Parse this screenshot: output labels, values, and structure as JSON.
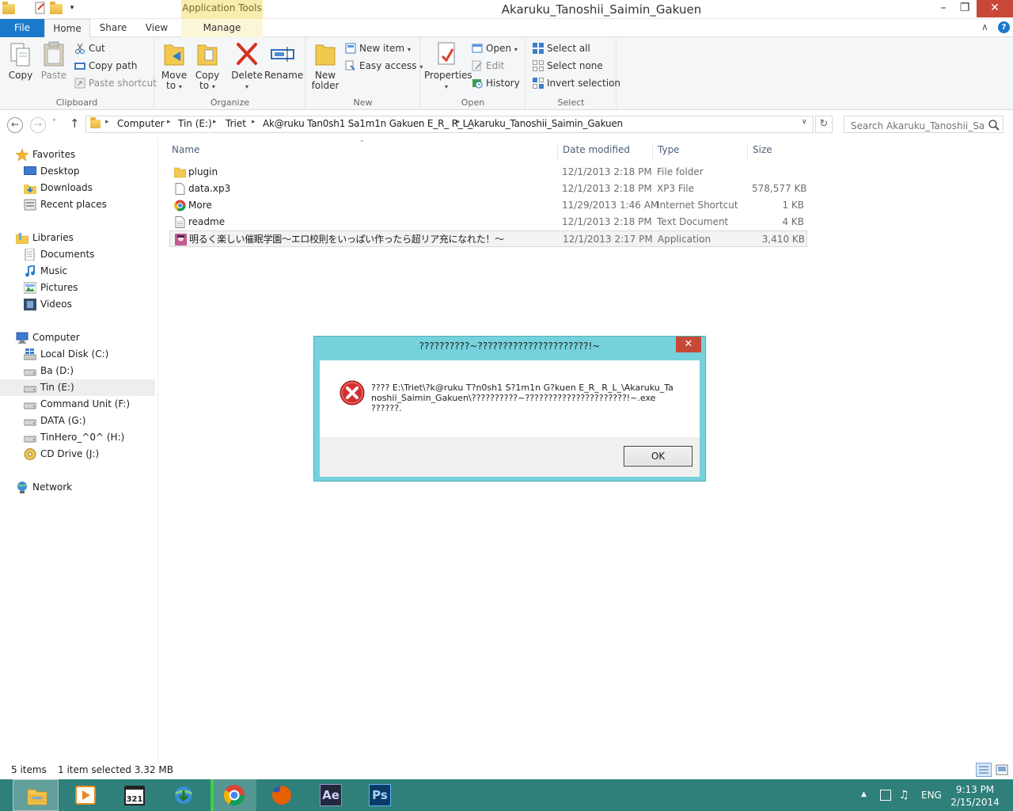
{
  "window": {
    "title": "Akaruku_Tanoshii_Saimin_Gakuen",
    "context_tab_label": "Application Tools",
    "minimize": "–",
    "maximize": "❐",
    "close": "✕"
  },
  "ribbon_tabs": {
    "file": "File",
    "home": "Home",
    "share": "Share",
    "view": "View",
    "manage": "Manage",
    "collapse": "∧",
    "help": "?"
  },
  "ribbon": {
    "clipboard": {
      "label": "Clipboard",
      "copy": "Copy",
      "paste": "Paste",
      "cut": "Cut",
      "copy_path": "Copy path",
      "paste_shortcut": "Paste shortcut"
    },
    "organize": {
      "label": "Organize",
      "move_to_1": "Move",
      "move_to_2": "to",
      "copy_to_1": "Copy",
      "copy_to_2": "to",
      "delete": "Delete",
      "rename": "Rename"
    },
    "new": {
      "label": "New",
      "new_folder_1": "New",
      "new_folder_2": "folder",
      "new_item": "New item",
      "easy_access": "Easy access"
    },
    "open": {
      "label": "Open",
      "properties": "Properties",
      "open": "Open",
      "edit": "Edit",
      "history": "History"
    },
    "select": {
      "label": "Select",
      "select_all": "Select all",
      "select_none": "Select none",
      "invert_selection": "Invert selection"
    }
  },
  "navigation": {
    "back": "←",
    "forward": "→",
    "recent": "˅",
    "up": "↑",
    "breadcrumbs": [
      "Computer",
      "Tin (E:)",
      "Triet",
      "Ak@ruku Tan0sh1 Sa1m1n Gakuen E_R_ R_L_",
      "Akaruku_Tanoshii_Saimin_Gakuen"
    ],
    "separator": "▸",
    "address_dropdown": "∨",
    "refresh": "↻",
    "search_placeholder": "Search Akaruku_Tanoshii_Sai..."
  },
  "nav_pane": {
    "favorites": "Favorites",
    "favorites_items": [
      "Desktop",
      "Downloads",
      "Recent places"
    ],
    "libraries": "Libraries",
    "libraries_items": [
      "Documents",
      "Music",
      "Pictures",
      "Videos"
    ],
    "computer": "Computer",
    "computer_items": [
      "Local Disk (C:)",
      "Ba (D:)",
      "Tin (E:)",
      "Command Unit (F:)",
      "DATA (G:)",
      "TinHero_^0^ (H:)",
      "CD Drive (J:)"
    ],
    "network": "Network"
  },
  "file_list": {
    "columns": {
      "name": "Name",
      "date": "Date modified",
      "type": "Type",
      "size": "Size"
    },
    "sort_indicator": "⌃",
    "rows": [
      {
        "name": "plugin",
        "date": "12/1/2013 2:18 PM",
        "type": "File folder",
        "size": "",
        "icon": "folder-icon"
      },
      {
        "name": "data.xp3",
        "date": "12/1/2013 2:18 PM",
        "type": "XP3 File",
        "size": "578,577 KB",
        "icon": "file-icon"
      },
      {
        "name": "More",
        "date": "11/29/2013 1:46 AM",
        "type": "Internet Shortcut",
        "size": "1 KB",
        "icon": "chrome-shortcut-icon"
      },
      {
        "name": "readme",
        "date": "12/1/2013 2:18 PM",
        "type": "Text Document",
        "size": "4 KB",
        "icon": "text-file-icon"
      },
      {
        "name": "明るく楽しい催眠学園～エロ校則をいっぱい作ったら超リア充になれた！～",
        "date": "12/1/2013 2:17 PM",
        "type": "Application",
        "size": "3,410 KB",
        "icon": "app-icon"
      }
    ]
  },
  "status_bar": {
    "item_count": "5 items",
    "selection": "1 item selected  3.32 MB"
  },
  "dialog": {
    "title": "??????????~??????????????????????!~",
    "message": "???? E:\\Triet\\?k@ruku T?n0sh1 S?1m1n G?kuen E_R_ R_L_\\Akaruku_Tanoshii_Saimin_Gakuen\\??????????~??????????????????????!~.exe ??????.",
    "ok": "OK",
    "close": "✕"
  },
  "taskbar": {
    "apps": [
      "file-explorer-icon",
      "media-player-icon",
      "media-player-classic-icon",
      "internet-download-manager-icon",
      "chrome-icon",
      "firefox-icon",
      "after-effects-icon",
      "photoshop-icon"
    ],
    "after_effects_label": "Ae",
    "photoshop_label": "Ps",
    "mpc_label": "321",
    "tray_up": "▲",
    "volume": "♫",
    "language": "ENG",
    "time": "9:13 PM",
    "date": "2/15/2014"
  }
}
